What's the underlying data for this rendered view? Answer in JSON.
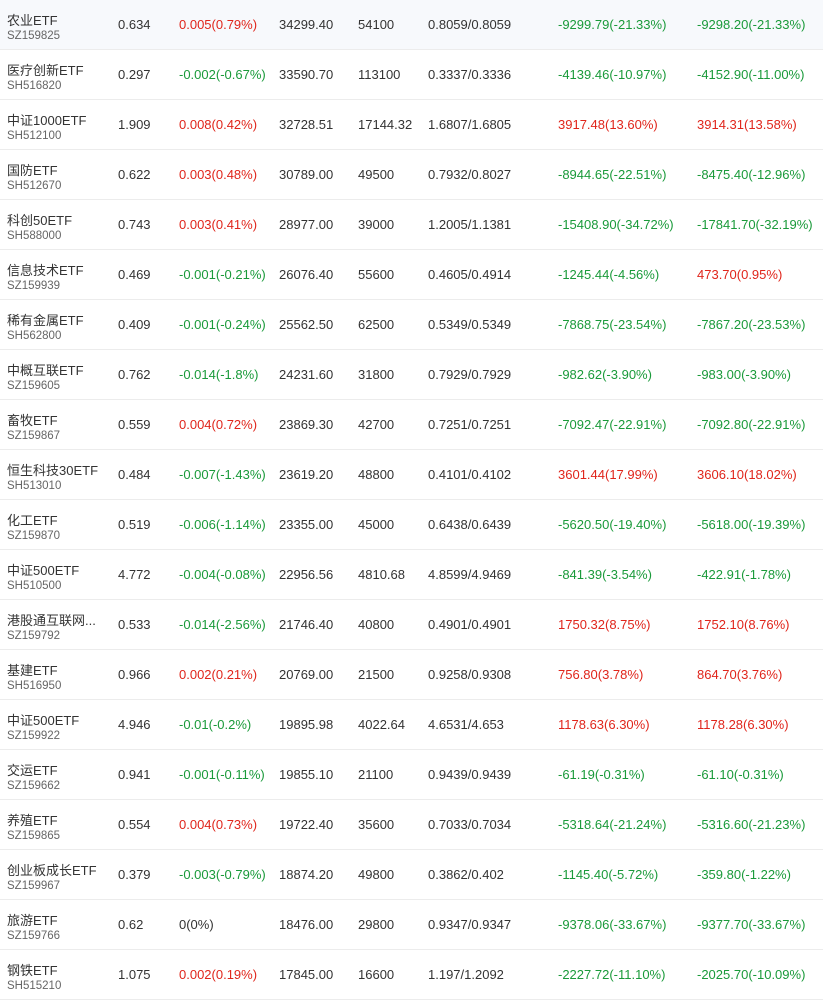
{
  "colors": {
    "up": "#e0251b",
    "down": "#1a9a3a",
    "flat": "#333333"
  },
  "rows": [
    {
      "name": "农业ETF",
      "code": "SZ159825",
      "price": "0.634",
      "change": "0.005(0.79%)",
      "change_dir": "up",
      "amount": "34299.40",
      "volume": "54100",
      "bid_ask": "0.8059/0.8059",
      "flow1": "-9299.79(-21.33%)",
      "flow1_dir": "down",
      "flow2": "-9298.20(-21.33%)",
      "flow2_dir": "down"
    },
    {
      "name": "医疗创新ETF",
      "code": "SH516820",
      "price": "0.297",
      "change": "-0.002(-0.67%)",
      "change_dir": "down",
      "amount": "33590.70",
      "volume": "113100",
      "bid_ask": "0.3337/0.3336",
      "flow1": "-4139.46(-10.97%)",
      "flow1_dir": "down",
      "flow2": "-4152.90(-11.00%)",
      "flow2_dir": "down"
    },
    {
      "name": "中证1000ETF",
      "code": "SH512100",
      "price": "1.909",
      "change": "0.008(0.42%)",
      "change_dir": "up",
      "amount": "32728.51",
      "volume": "17144.32",
      "bid_ask": "1.6807/1.6805",
      "flow1": "3917.48(13.60%)",
      "flow1_dir": "up",
      "flow2": "3914.31(13.58%)",
      "flow2_dir": "up"
    },
    {
      "name": "国防ETF",
      "code": "SH512670",
      "price": "0.622",
      "change": "0.003(0.48%)",
      "change_dir": "up",
      "amount": "30789.00",
      "volume": "49500",
      "bid_ask": "0.7932/0.8027",
      "flow1": "-8944.65(-22.51%)",
      "flow1_dir": "down",
      "flow2": "-8475.40(-12.96%)",
      "flow2_dir": "down"
    },
    {
      "name": "科创50ETF",
      "code": "SH588000",
      "price": "0.743",
      "change": "0.003(0.41%)",
      "change_dir": "up",
      "amount": "28977.00",
      "volume": "39000",
      "bid_ask": "1.2005/1.1381",
      "flow1": "-15408.90(-34.72%)",
      "flow1_dir": "down",
      "flow2": "-17841.70(-32.19%)",
      "flow2_dir": "down"
    },
    {
      "name": "信息技术ETF",
      "code": "SZ159939",
      "price": "0.469",
      "change": "-0.001(-0.21%)",
      "change_dir": "down",
      "amount": "26076.40",
      "volume": "55600",
      "bid_ask": "0.4605/0.4914",
      "flow1": "-1245.44(-4.56%)",
      "flow1_dir": "down",
      "flow2": "473.70(0.95%)",
      "flow2_dir": "up"
    },
    {
      "name": "稀有金属ETF",
      "code": "SH562800",
      "price": "0.409",
      "change": "-0.001(-0.24%)",
      "change_dir": "down",
      "amount": "25562.50",
      "volume": "62500",
      "bid_ask": "0.5349/0.5349",
      "flow1": "-7868.75(-23.54%)",
      "flow1_dir": "down",
      "flow2": "-7867.20(-23.53%)",
      "flow2_dir": "down"
    },
    {
      "name": "中概互联ETF",
      "code": "SZ159605",
      "price": "0.762",
      "change": "-0.014(-1.8%)",
      "change_dir": "down",
      "amount": "24231.60",
      "volume": "31800",
      "bid_ask": "0.7929/0.7929",
      "flow1": "-982.62(-3.90%)",
      "flow1_dir": "down",
      "flow2": "-983.00(-3.90%)",
      "flow2_dir": "down"
    },
    {
      "name": "畜牧ETF",
      "code": "SZ159867",
      "price": "0.559",
      "change": "0.004(0.72%)",
      "change_dir": "up",
      "amount": "23869.30",
      "volume": "42700",
      "bid_ask": "0.7251/0.7251",
      "flow1": "-7092.47(-22.91%)",
      "flow1_dir": "down",
      "flow2": "-7092.80(-22.91%)",
      "flow2_dir": "down"
    },
    {
      "name": "恒生科技30ETF",
      "code": "SH513010",
      "price": "0.484",
      "change": "-0.007(-1.43%)",
      "change_dir": "down",
      "amount": "23619.20",
      "volume": "48800",
      "bid_ask": "0.4101/0.4102",
      "flow1": "3601.44(17.99%)",
      "flow1_dir": "up",
      "flow2": "3606.10(18.02%)",
      "flow2_dir": "up"
    },
    {
      "name": "化工ETF",
      "code": "SZ159870",
      "price": "0.519",
      "change": "-0.006(-1.14%)",
      "change_dir": "down",
      "amount": "23355.00",
      "volume": "45000",
      "bid_ask": "0.6438/0.6439",
      "flow1": "-5620.50(-19.40%)",
      "flow1_dir": "down",
      "flow2": "-5618.00(-19.39%)",
      "flow2_dir": "down"
    },
    {
      "name": "中证500ETF",
      "code": "SH510500",
      "price": "4.772",
      "change": "-0.004(-0.08%)",
      "change_dir": "down",
      "amount": "22956.56",
      "volume": "4810.68",
      "bid_ask": "4.8599/4.9469",
      "flow1": "-841.39(-3.54%)",
      "flow1_dir": "down",
      "flow2": "-422.91(-1.78%)",
      "flow2_dir": "down"
    },
    {
      "name": "港股通互联网...",
      "code": "SZ159792",
      "price": "0.533",
      "change": "-0.014(-2.56%)",
      "change_dir": "down",
      "amount": "21746.40",
      "volume": "40800",
      "bid_ask": "0.4901/0.4901",
      "flow1": "1750.32(8.75%)",
      "flow1_dir": "up",
      "flow2": "1752.10(8.76%)",
      "flow2_dir": "up"
    },
    {
      "name": "基建ETF",
      "code": "SH516950",
      "price": "0.966",
      "change": "0.002(0.21%)",
      "change_dir": "up",
      "amount": "20769.00",
      "volume": "21500",
      "bid_ask": "0.9258/0.9308",
      "flow1": "756.80(3.78%)",
      "flow1_dir": "up",
      "flow2": "864.70(3.76%)",
      "flow2_dir": "up"
    },
    {
      "name": "中证500ETF",
      "code": "SZ159922",
      "price": "4.946",
      "change": "-0.01(-0.2%)",
      "change_dir": "down",
      "amount": "19895.98",
      "volume": "4022.64",
      "bid_ask": "4.6531/4.653",
      "flow1": "1178.63(6.30%)",
      "flow1_dir": "up",
      "flow2": "1178.28(6.30%)",
      "flow2_dir": "up"
    },
    {
      "name": "交运ETF",
      "code": "SZ159662",
      "price": "0.941",
      "change": "-0.001(-0.11%)",
      "change_dir": "down",
      "amount": "19855.10",
      "volume": "21100",
      "bid_ask": "0.9439/0.9439",
      "flow1": "-61.19(-0.31%)",
      "flow1_dir": "down",
      "flow2": "-61.10(-0.31%)",
      "flow2_dir": "down"
    },
    {
      "name": "养殖ETF",
      "code": "SZ159865",
      "price": "0.554",
      "change": "0.004(0.73%)",
      "change_dir": "up",
      "amount": "19722.40",
      "volume": "35600",
      "bid_ask": "0.7033/0.7034",
      "flow1": "-5318.64(-21.24%)",
      "flow1_dir": "down",
      "flow2": "-5316.60(-21.23%)",
      "flow2_dir": "down"
    },
    {
      "name": "创业板成长ETF",
      "code": "SZ159967",
      "price": "0.379",
      "change": "-0.003(-0.79%)",
      "change_dir": "down",
      "amount": "18874.20",
      "volume": "49800",
      "bid_ask": "0.3862/0.402",
      "flow1": "-1145.40(-5.72%)",
      "flow1_dir": "down",
      "flow2": "-359.80(-1.22%)",
      "flow2_dir": "down"
    },
    {
      "name": "旅游ETF",
      "code": "SZ159766",
      "price": "0.62",
      "change": "0(0%)",
      "change_dir": "flat",
      "amount": "18476.00",
      "volume": "29800",
      "bid_ask": "0.9347/0.9347",
      "flow1": "-9378.06(-33.67%)",
      "flow1_dir": "down",
      "flow2": "-9377.70(-33.67%)",
      "flow2_dir": "down"
    },
    {
      "name": "钢铁ETF",
      "code": "SH515210",
      "price": "1.075",
      "change": "0.002(0.19%)",
      "change_dir": "up",
      "amount": "17845.00",
      "volume": "16600",
      "bid_ask": "1.197/1.2092",
      "flow1": "-2227.72(-11.10%)",
      "flow1_dir": "down",
      "flow2": "-2025.70(-10.09%)",
      "flow2_dir": "down"
    }
  ]
}
